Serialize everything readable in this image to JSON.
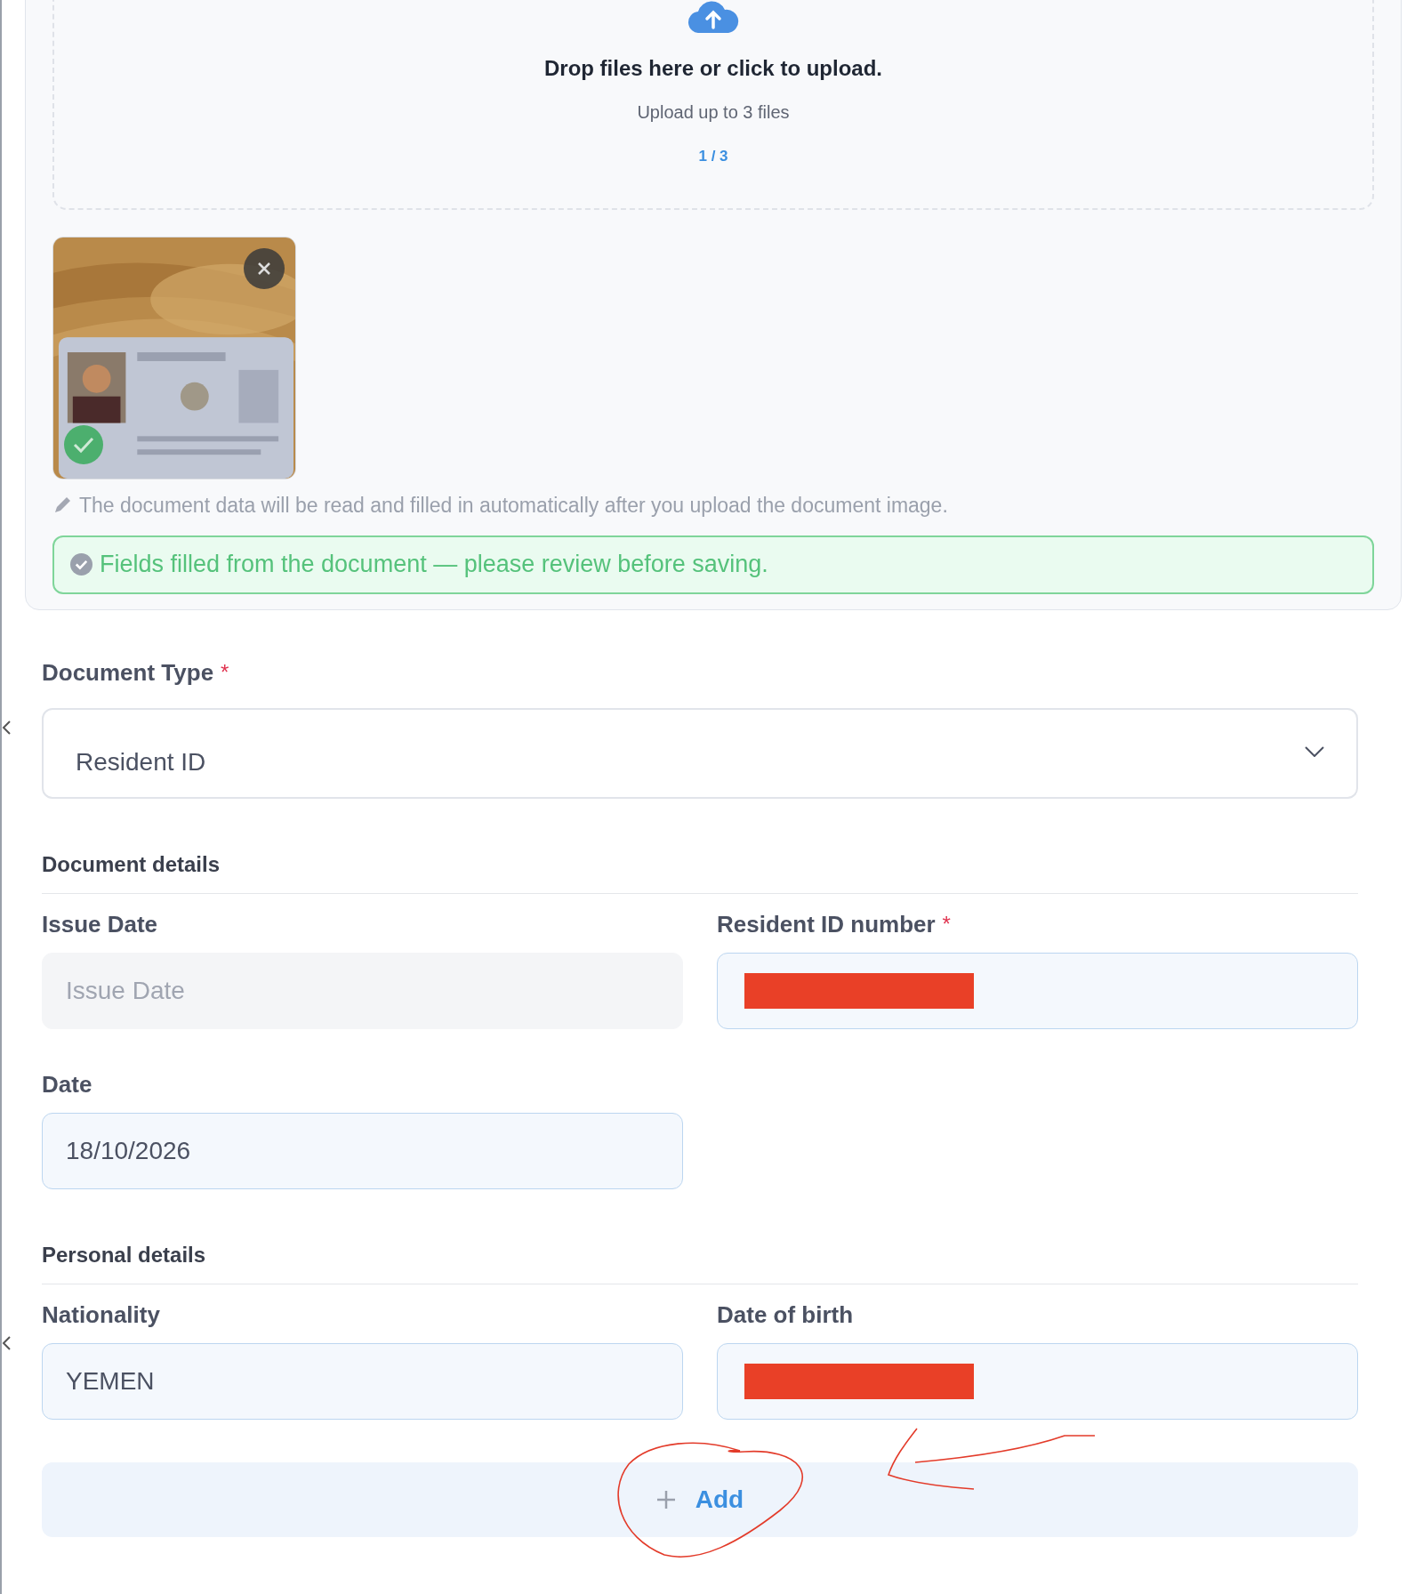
{
  "upload": {
    "title": "Drop files here or click to upload.",
    "subtitle": "Upload up to 3 files",
    "counter": "1 / 3",
    "thumbnails": [
      {
        "kind": "picture",
        "verified": true
      }
    ],
    "hint": "The document data will be read and filled in automatically after you upload the document image.",
    "alert": "Fields filled from the document — please review before saving."
  },
  "document_type": {
    "label": "Document Type",
    "required_mark": "*",
    "value": "Resident ID"
  },
  "sections": [
    {
      "title": "Document details",
      "fields": [
        {
          "label": "Issue Date",
          "placeholder": "Issue Date",
          "disabled": true,
          "redacted": false
        },
        {
          "label": "Resident ID number",
          "required_mark": "*",
          "disabled": false,
          "redacted": true
        },
        {
          "label": "Date",
          "value": "18/10/2026",
          "disabled": false,
          "redacted": false
        }
      ]
    },
    {
      "title": "Personal details",
      "fields": [
        {
          "label": "Nationality",
          "value": "YEMEN",
          "disabled": false,
          "redacted": false
        },
        {
          "label": "Date of birth",
          "disabled": false,
          "redacted": true
        }
      ]
    }
  ],
  "add_button": {
    "label": "Add"
  }
}
